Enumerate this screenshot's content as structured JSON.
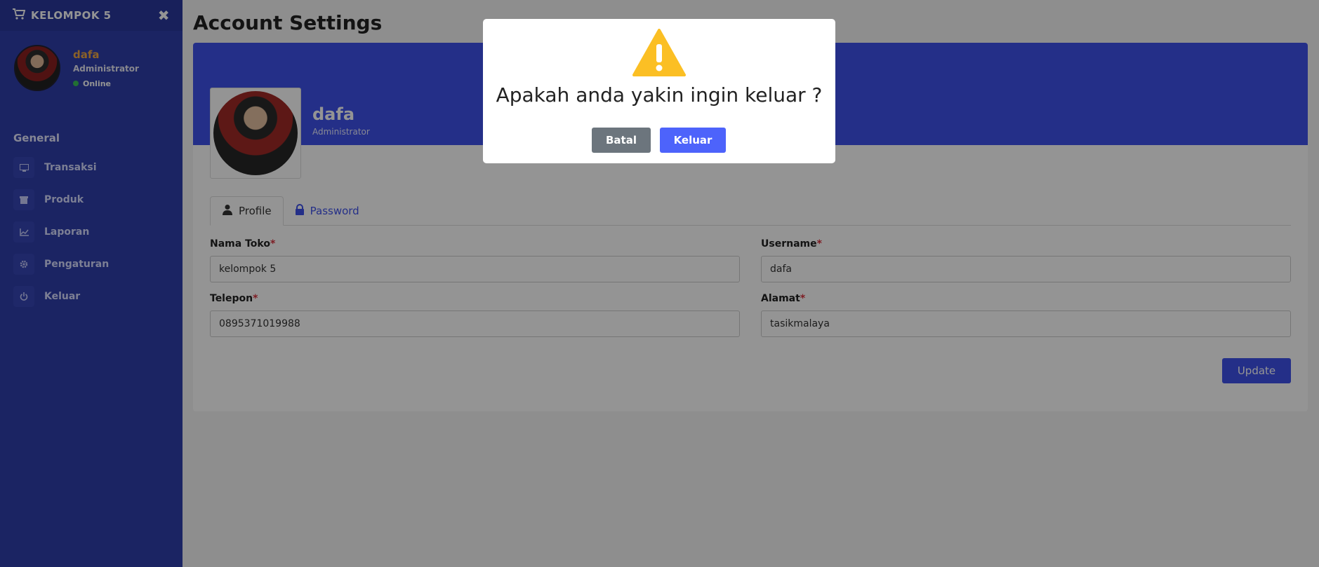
{
  "sidebar": {
    "brand": "KELOMPOK 5",
    "user": {
      "name": "dafa",
      "role": "Administrator",
      "status": "Online"
    },
    "section_title": "General",
    "items": [
      {
        "label": "Transaksi",
        "icon": "monitor-icon"
      },
      {
        "label": "Produk",
        "icon": "box-icon"
      },
      {
        "label": "Laporan",
        "icon": "chart-icon"
      },
      {
        "label": "Pengaturan",
        "icon": "gear-icon"
      },
      {
        "label": "Keluar",
        "icon": "power-icon"
      }
    ]
  },
  "main": {
    "page_title": "Account Settings",
    "profile": {
      "name": "dafa",
      "role": "Administrator"
    },
    "tabs": [
      {
        "label": "Profile",
        "icon": "user-icon",
        "active": true
      },
      {
        "label": "Password",
        "icon": "lock-icon",
        "active": false
      }
    ],
    "form": {
      "nama_toko": {
        "label": "Nama Toko",
        "value": "kelompok 5"
      },
      "username": {
        "label": "Username",
        "value": "dafa"
      },
      "telepon": {
        "label": "Telepon",
        "value": "0895371019988"
      },
      "alamat": {
        "label": "Alamat",
        "value": "tasikmalaya"
      },
      "required_mark": "*",
      "update_label": "Update"
    }
  },
  "modal": {
    "icon": "warning-icon",
    "title": "Apakah anda yakin ingin keluar ?",
    "cancel_label": "Batal",
    "confirm_label": "Keluar"
  },
  "colors": {
    "sidebar": "#2f3eab",
    "accent": "#3f51ea",
    "warning": "#fbbf24",
    "cancel": "#6c757d"
  }
}
